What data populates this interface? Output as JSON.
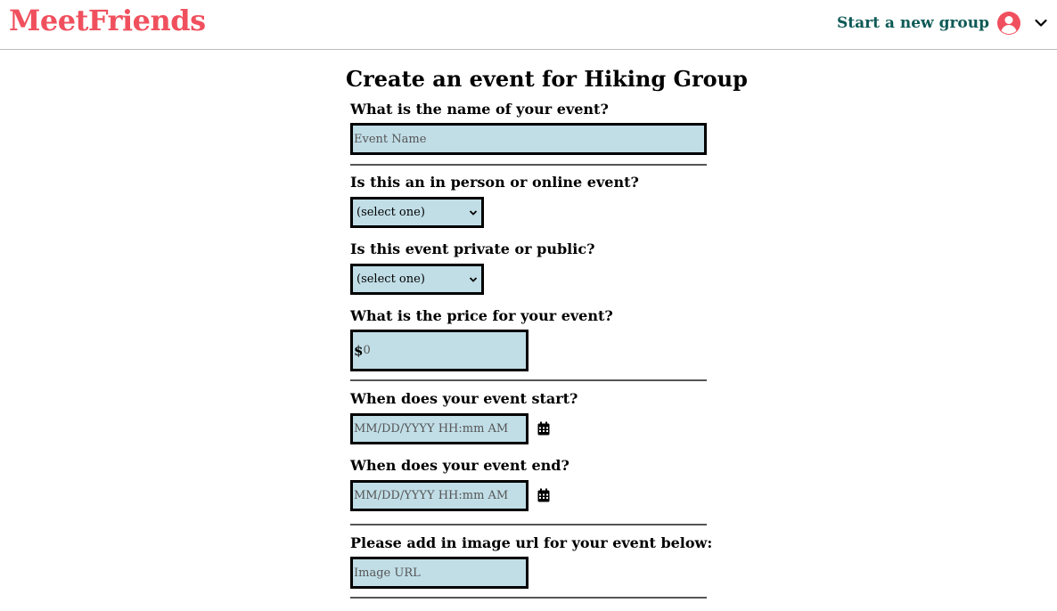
{
  "header": {
    "logo": "MeetFriends",
    "new_group_link": "Start a new group",
    "avatar_icon": "user-circle-icon",
    "menu_icon": "chevron-down-icon",
    "colors": {
      "logo": "#f0505e",
      "link": "#0e5a56",
      "input_bg": "#c1dee7"
    }
  },
  "form": {
    "title": "Create an event for Hiking Group",
    "name_label": "What is the name of your event?",
    "name_placeholder": "Event Name",
    "type_label": "Is this an in person or online event?",
    "type_selected": "(select one)",
    "privacy_label": "Is this event private or public?",
    "privacy_selected": "(select one)",
    "price_label": "What is the price for your event?",
    "price_symbol": "$",
    "price_placeholder": "0",
    "start_label": "When does your event start?",
    "start_placeholder": "MM/DD/YYYY HH:mm AM",
    "end_label": "When does your event end?",
    "end_placeholder": "MM/DD/YYYY HH:mm AM",
    "image_label": "Please add in image url for your event below:",
    "image_placeholder": "Image URL",
    "calendar_icon": "calendar-icon"
  }
}
